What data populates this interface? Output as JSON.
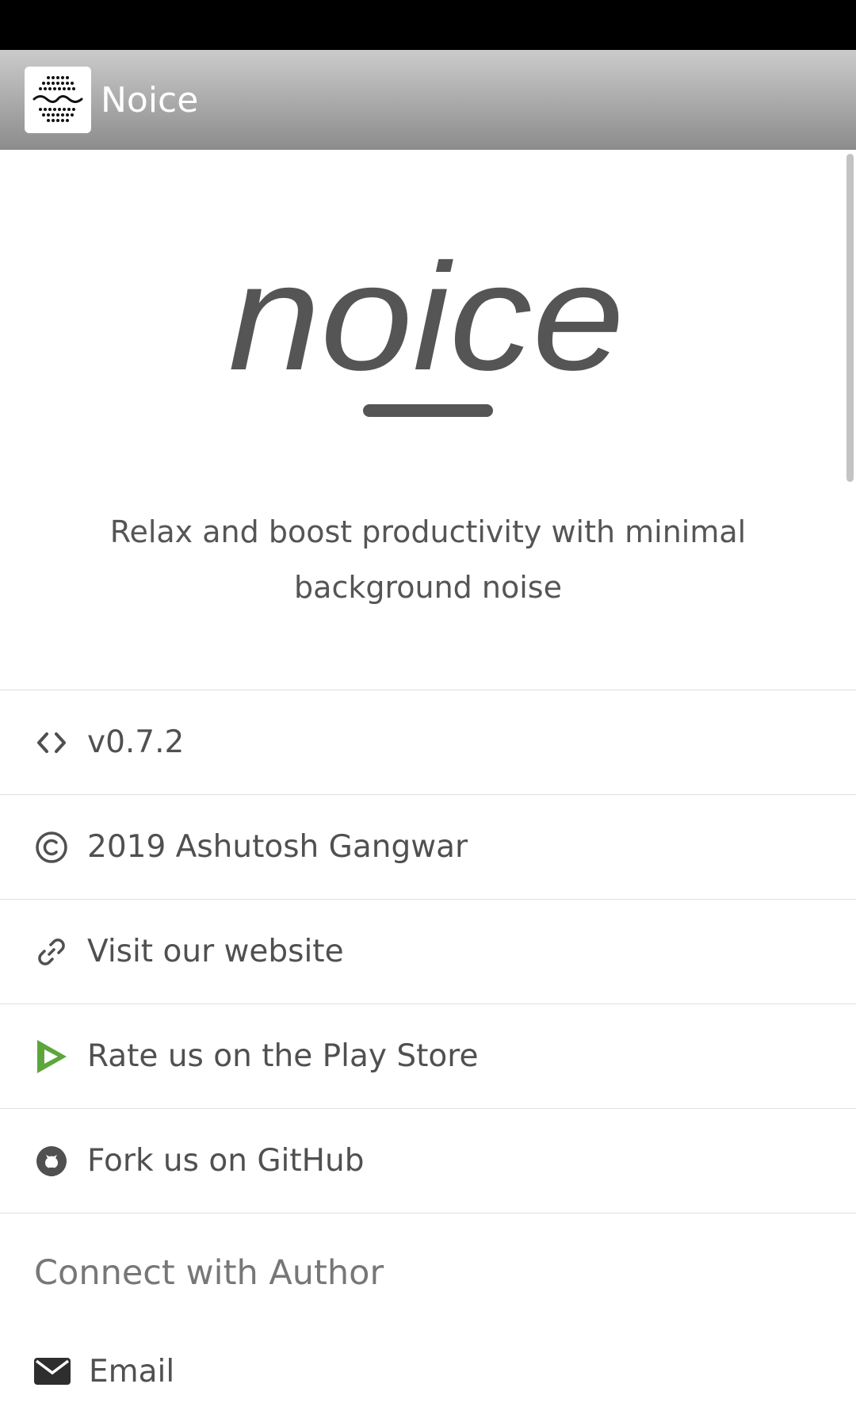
{
  "app_bar": {
    "title": "Noice",
    "icon": "app-logo-icon"
  },
  "logo": {
    "wordmark": "noice"
  },
  "tagline": {
    "line1": "Relax and boost productivity with minimal",
    "line2": "background noise"
  },
  "items": [
    {
      "label": "v0.7.2",
      "icon": "code-icon"
    },
    {
      "label": "2019 Ashutosh Gangwar",
      "icon": "copyright-icon"
    },
    {
      "label": "Visit our website",
      "icon": "link-icon"
    },
    {
      "label": "Rate us on the Play Store",
      "icon": "play-store-icon"
    },
    {
      "label": "Fork us on GitHub",
      "icon": "github-icon"
    }
  ],
  "section": {
    "title": "Connect with Author"
  },
  "contact": [
    {
      "label": "Email",
      "icon": "email-icon"
    }
  ],
  "colors": {
    "text": "#505050",
    "logo": "#555555",
    "play_store": "#5ea53b",
    "status_bar": "#000000"
  }
}
